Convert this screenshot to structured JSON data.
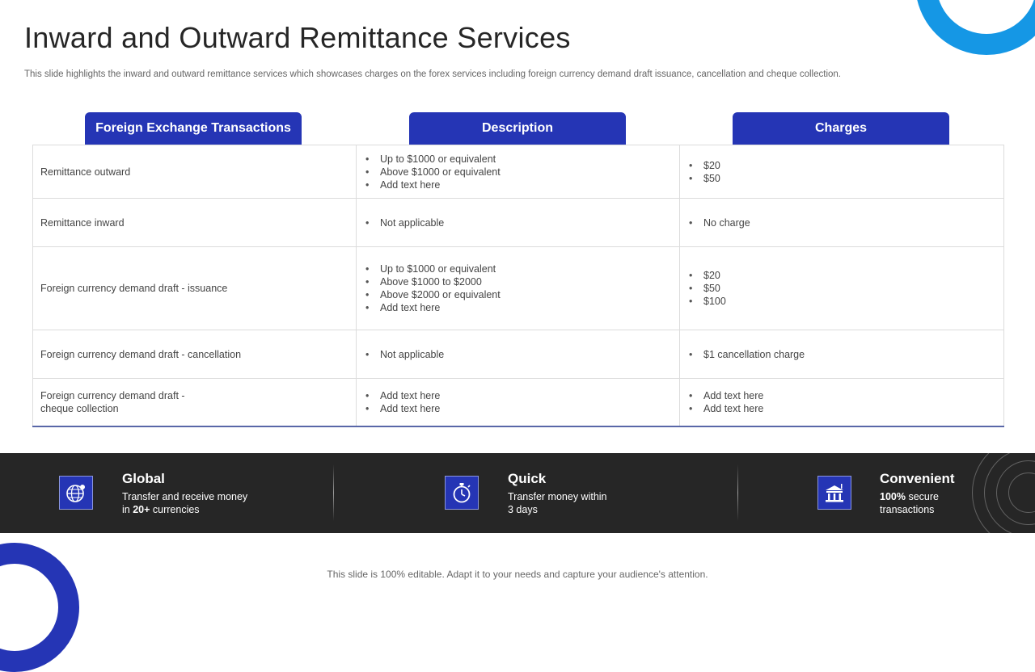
{
  "header": {
    "title": "Inward and Outward Remittance Services",
    "subtitle": "This slide highlights the inward and outward remittance services which showcases charges on the forex services including foreign currency demand draft issuance, cancellation and cheque collection."
  },
  "table": {
    "columns": [
      "Foreign Exchange Transactions",
      "Description",
      "Charges"
    ],
    "rows": [
      {
        "transaction": [
          "Remittance outward"
        ],
        "description": [
          "Up to $1000  or equivalent",
          "Above  $1000  or equivalent",
          "Add text here"
        ],
        "charges": [
          "$20",
          "$50"
        ]
      },
      {
        "transaction": [
          "Remittance inward"
        ],
        "description": [
          "Not applicable"
        ],
        "charges": [
          "No charge"
        ]
      },
      {
        "transaction": [
          "Foreign  currency demand  draft  - issuance"
        ],
        "description": [
          "Up to $1000  or equivalent",
          "Above  $1000 to $2000",
          "Above  $2000  or equivalent",
          "Add text here"
        ],
        "charges": [
          "$20",
          "$50",
          "$100"
        ]
      },
      {
        "transaction": [
          "Foreign  currency demand  draft  - cancellation"
        ],
        "description": [
          "Not applicable"
        ],
        "charges": [
          "$1 cancellation charge"
        ]
      },
      {
        "transaction": [
          "Foreign  currency demand  draft  -",
          "cheque collection"
        ],
        "description": [
          "Add text here",
          "Add text here"
        ],
        "charges": [
          "Add text here",
          "Add text here"
        ]
      }
    ]
  },
  "features": [
    {
      "icon": "globe-icon",
      "title": "Global",
      "line1": "Transfer  and  receive  money",
      "line2_pre": "in ",
      "line2_bold": "20+",
      "line2_post": " currencies"
    },
    {
      "icon": "stopwatch-icon",
      "title": "Quick",
      "line1": "Transfer  money  within",
      "line2": "3 days"
    },
    {
      "icon": "bank-icon",
      "title": "Convenient",
      "line1_bold": "100%",
      "line1_post": "  secure",
      "line2": "transactions"
    }
  ],
  "footer": {
    "note": "This slide is 100% editable. Adapt it to your needs and capture your audience's attention."
  },
  "colors": {
    "accent_blue": "#2535b5",
    "corner_blue": "#1597e5",
    "band_dark": "#262626"
  }
}
